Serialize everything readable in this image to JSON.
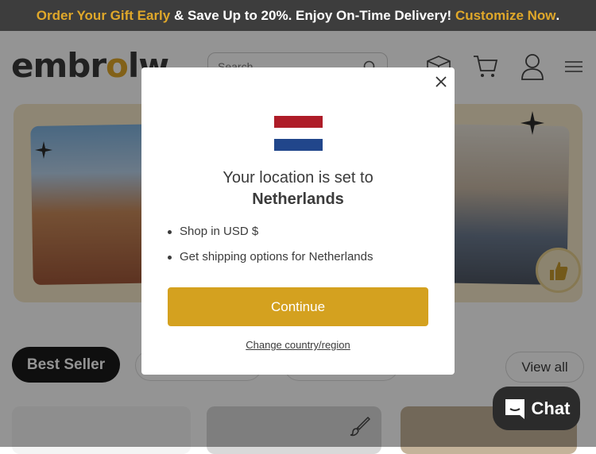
{
  "promo": {
    "part1": "Order Your Gift Early",
    "part2": " & Save Up to 20%. Enjoy On-Time Delivery! ",
    "part3": "Customize Now",
    "part4": ".",
    "accent": "#e0a82a",
    "background": "#3d3d3d"
  },
  "header": {
    "logo_pre": "embr",
    "logo_o": "o",
    "logo_post": "lw",
    "search_placeholder": "Search",
    "icons": [
      "box-icon",
      "cart-icon",
      "user-icon",
      "menu-icon"
    ]
  },
  "modal": {
    "title": "Your location is set to",
    "country": "Netherlands",
    "bullet_shop_prefix": "Shop in ",
    "bullet_shop_currency": "USD $",
    "bullet_shipping_prefix": "Get shipping options for ",
    "bullet_shipping_country": "Netherlands",
    "continue_label": "Continue",
    "change_label": "Change country/region",
    "button_color": "#d4a11f",
    "flag_colors": [
      "#ae1c28",
      "#ffffff",
      "#21468b"
    ]
  },
  "tabs": {
    "best_seller": "Best Seller",
    "view_all": "View all"
  },
  "chat": {
    "label": "Chat"
  }
}
